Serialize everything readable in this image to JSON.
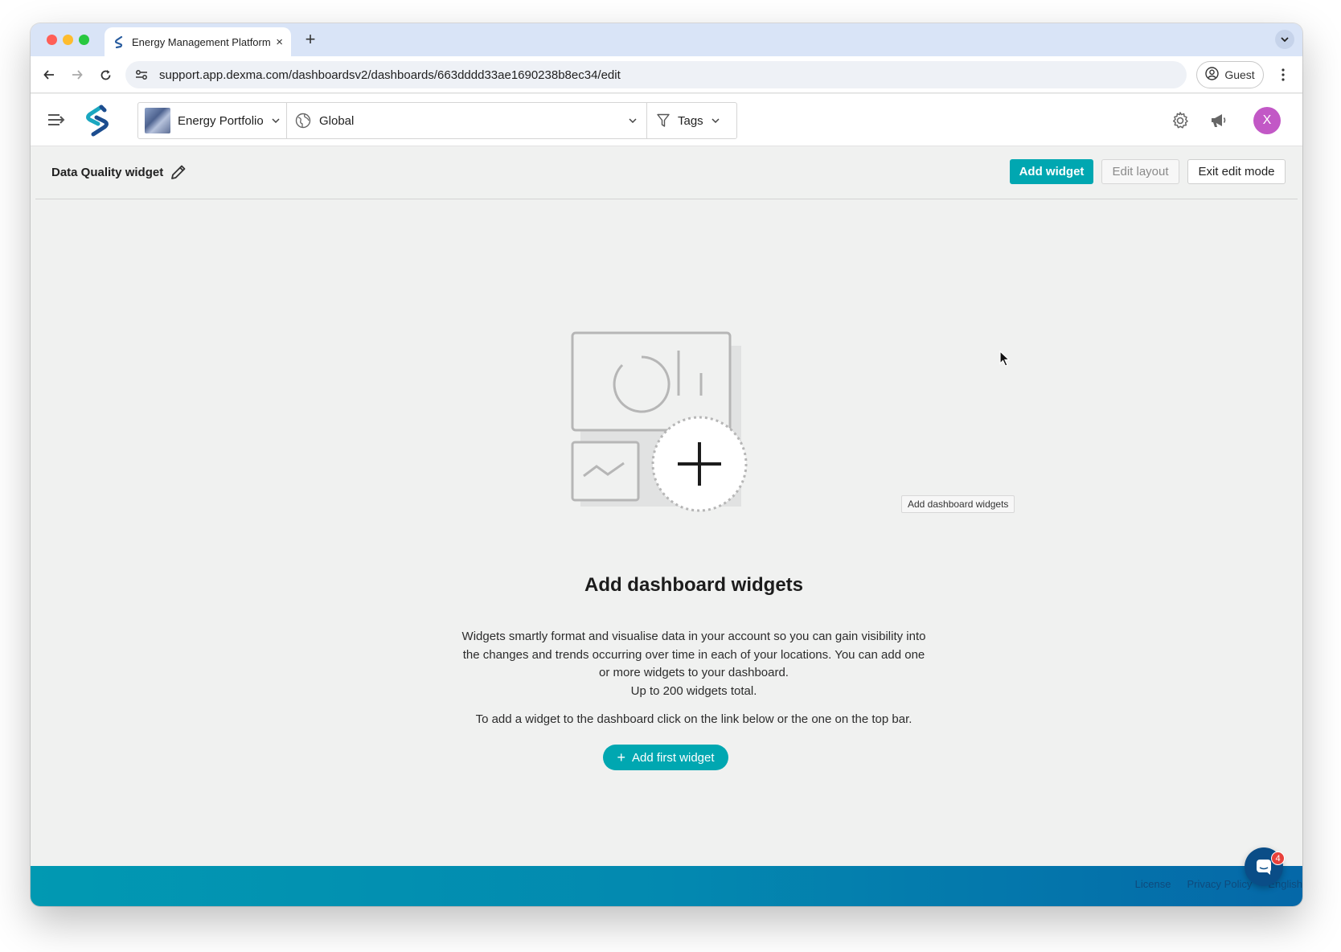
{
  "browser": {
    "tab_title": "Energy Management Platform",
    "tab_close": "×",
    "new_tab": "+",
    "url": "support.app.dexma.com/dashboardsv2/dashboards/663dddd33ae1690238b8ec34/edit",
    "profile_label": "Guest"
  },
  "header": {
    "portfolio_label": "Energy Portfolio",
    "location_label": "Global",
    "tags_label": "Tags",
    "avatar_initial": "X",
    "accent_color": "#00a7b1"
  },
  "page": {
    "title": "Data Quality widget",
    "add_widget_label": "Add widget",
    "edit_layout_label": "Edit layout",
    "exit_edit_label": "Exit edit mode"
  },
  "empty_state": {
    "title": "Add dashboard widgets",
    "description_lines": [
      "Widgets smartly format and visualise data in your account so you can gain visibility into",
      "the changes and trends occurring over time in each of your locations. You can add one",
      "or more widgets to your dashboard.",
      "Up to 200 widgets total."
    ],
    "hint": "To add a widget to the dashboard click on the link below or the one on the top bar.",
    "button_label": "Add first widget",
    "button_icon": "+"
  },
  "tooltip": {
    "text": "Add dashboard widgets"
  },
  "footer": {
    "links": [
      "License",
      "Privacy Policy",
      "English"
    ],
    "chat_badge": "4"
  }
}
